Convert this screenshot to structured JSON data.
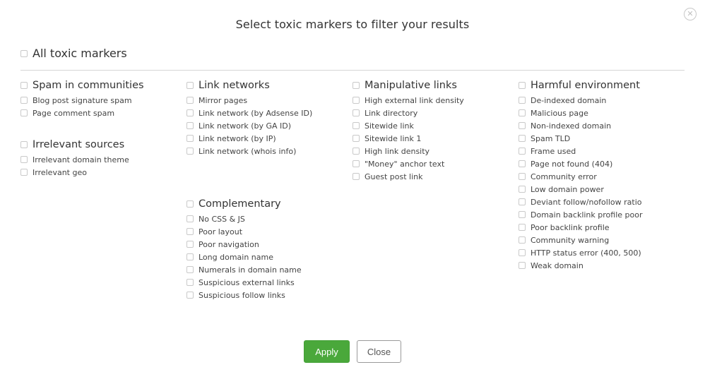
{
  "dialog": {
    "title": "Select toxic markers to filter your results",
    "close_icon": "circle-x-icon",
    "all_label": "All toxic markers"
  },
  "groups": [
    {
      "label": "Spam in communities",
      "items": [
        "Blog post signature spam",
        "Page comment spam"
      ]
    },
    {
      "label": "Irrelevant sources",
      "items": [
        "Irrelevant domain theme",
        "Irrelevant geo"
      ]
    },
    {
      "label": "Link networks",
      "items": [
        "Mirror pages",
        "Link network (by Adsense ID)",
        "Link network (by GA ID)",
        "Link network (by IP)",
        "Link network (whois info)"
      ]
    },
    {
      "label": "Complementary",
      "items": [
        "No CSS & JS",
        "Poor layout",
        "Poor navigation",
        "Long domain name",
        "Numerals in domain name",
        "Suspicious external links",
        "Suspicious follow links"
      ]
    },
    {
      "label": "Manipulative links",
      "items": [
        "High external link density",
        "Link directory",
        "Sitewide link",
        "Sitewide link 1",
        "High link density",
        "\"Money\" anchor text",
        "Guest post link"
      ]
    },
    {
      "label": "Harmful environment",
      "items": [
        "De-indexed domain",
        "Malicious page",
        "Non-indexed domain",
        "Spam TLD",
        "Frame used",
        "Page not found (404)",
        "Community error",
        "Low domain power",
        "Deviant follow/nofollow ratio",
        "Domain backlink profile poor",
        "Poor backlink profile",
        "Community warning",
        "HTTP status error (400, 500)",
        "Weak domain"
      ]
    }
  ],
  "buttons": {
    "apply": "Apply",
    "close": "Close"
  },
  "colors": {
    "apply_bg": "#4aa83b",
    "divider": "#d6d6d6"
  }
}
